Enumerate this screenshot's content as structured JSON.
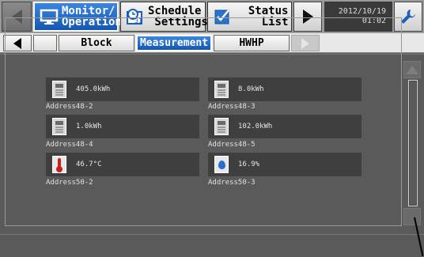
{
  "topbar": {
    "monitor_label": "Monitor/\nOperation",
    "schedule_label": "Schedule\n Settings",
    "status_label": "Status\n    List",
    "date": "2012/10/19",
    "time": "01:02"
  },
  "subtabs": {
    "block": "Block",
    "measurement": "Measurement",
    "hwhp": "HWHP"
  },
  "items": [
    {
      "icon": "meter-icon",
      "value": "405.0kWh",
      "label": "Address48-2"
    },
    {
      "icon": "meter-icon",
      "value": "8.0kWh",
      "label": "Address48-3"
    },
    {
      "icon": "meter-icon",
      "value": "1.0kWh",
      "label": "Address48-4"
    },
    {
      "icon": "meter-icon",
      "value": "102.0kWh",
      "label": "Address48-5"
    },
    {
      "icon": "thermometer-icon",
      "value": "46.7°C",
      "label": "Address50-2"
    },
    {
      "icon": "humidity-drop-icon",
      "value": "16.9%",
      "label": "Address50-3"
    }
  ],
  "colors": {
    "accent": "#1f6fd0",
    "background": "#5a5a5a",
    "item_box": "#3f3f3f"
  }
}
